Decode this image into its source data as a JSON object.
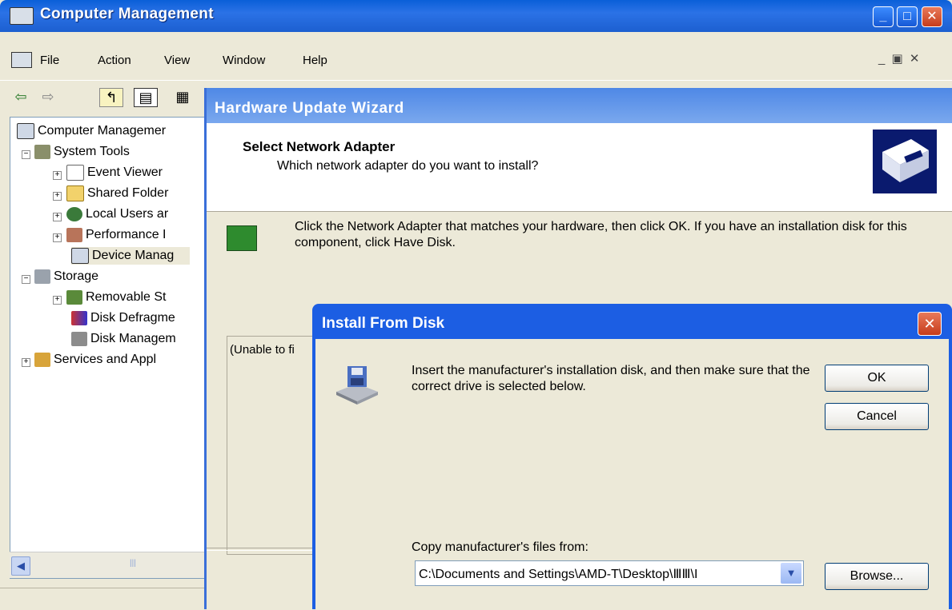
{
  "main_window": {
    "title": "Computer Management",
    "menu": [
      "File",
      "Action",
      "View",
      "Window",
      "Help"
    ],
    "title_buttons": {
      "minimize": "_",
      "maximize": "□",
      "close": "✕"
    },
    "mdi_buttons": "_ ▣ ✕",
    "tree": [
      {
        "label": "Computer Managemer",
        "level": 0,
        "expander": ""
      },
      {
        "label": "System Tools",
        "level": 1,
        "expander": "−"
      },
      {
        "label": "Event Viewer",
        "level": 2,
        "expander": "+"
      },
      {
        "label": "Shared Folder",
        "level": 2,
        "expander": "+"
      },
      {
        "label": "Local Users ar",
        "level": 2,
        "expander": "+"
      },
      {
        "label": "Performance I",
        "level": 2,
        "expander": "+"
      },
      {
        "label": "Device Manag",
        "level": 2,
        "expander": ""
      },
      {
        "label": "Storage",
        "level": 1,
        "expander": "−"
      },
      {
        "label": "Removable St",
        "level": 2,
        "expander": "+"
      },
      {
        "label": "Disk Defragme",
        "level": 2,
        "expander": ""
      },
      {
        "label": "Disk Managem",
        "level": 2,
        "expander": ""
      },
      {
        "label": "Services and Appl",
        "level": 1,
        "expander": "+"
      }
    ],
    "scroll_thumb_label": "|||"
  },
  "wizard": {
    "title": "Hardware Update Wizard",
    "heading": "Select Network Adapter",
    "subheading": "Which network adapter do you want to install?",
    "description": "Click the Network Adapter that matches your hardware, then click OK. If you have an installation disk for this component, click Have Disk.",
    "list_text": "(Unable to fi"
  },
  "install_dialog": {
    "title": "Install From Disk",
    "close_label": "✕",
    "message": "Insert the manufacturer's installation disk, and then make sure that the correct drive is selected below.",
    "ok_label": "OK",
    "cancel_label": "Cancel",
    "copy_label": "Copy manufacturer's files from:",
    "path_value": "C:\\Documents and Settings\\AMD-T\\Desktop\\ⅢⅢ\\I",
    "browse_label": "Browse...",
    "dropdown_arrow": "▼"
  }
}
